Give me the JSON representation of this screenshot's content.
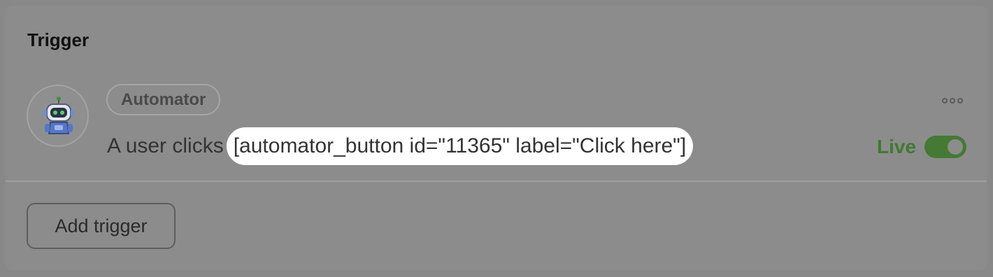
{
  "card": {
    "title": "Trigger"
  },
  "trigger": {
    "integration_badge": "Automator",
    "sentence_prefix": "A user clicks",
    "sentence_token": "[automator_button id=\"11365\" label=\"Click here\"]",
    "avatar_icon": "robot-mascot-icon",
    "more_icon": "ellipsis-icon",
    "status_label": "Live",
    "status_on": true,
    "status_color": "#3f7a30"
  },
  "actions": {
    "add_trigger_label": "Add trigger"
  }
}
